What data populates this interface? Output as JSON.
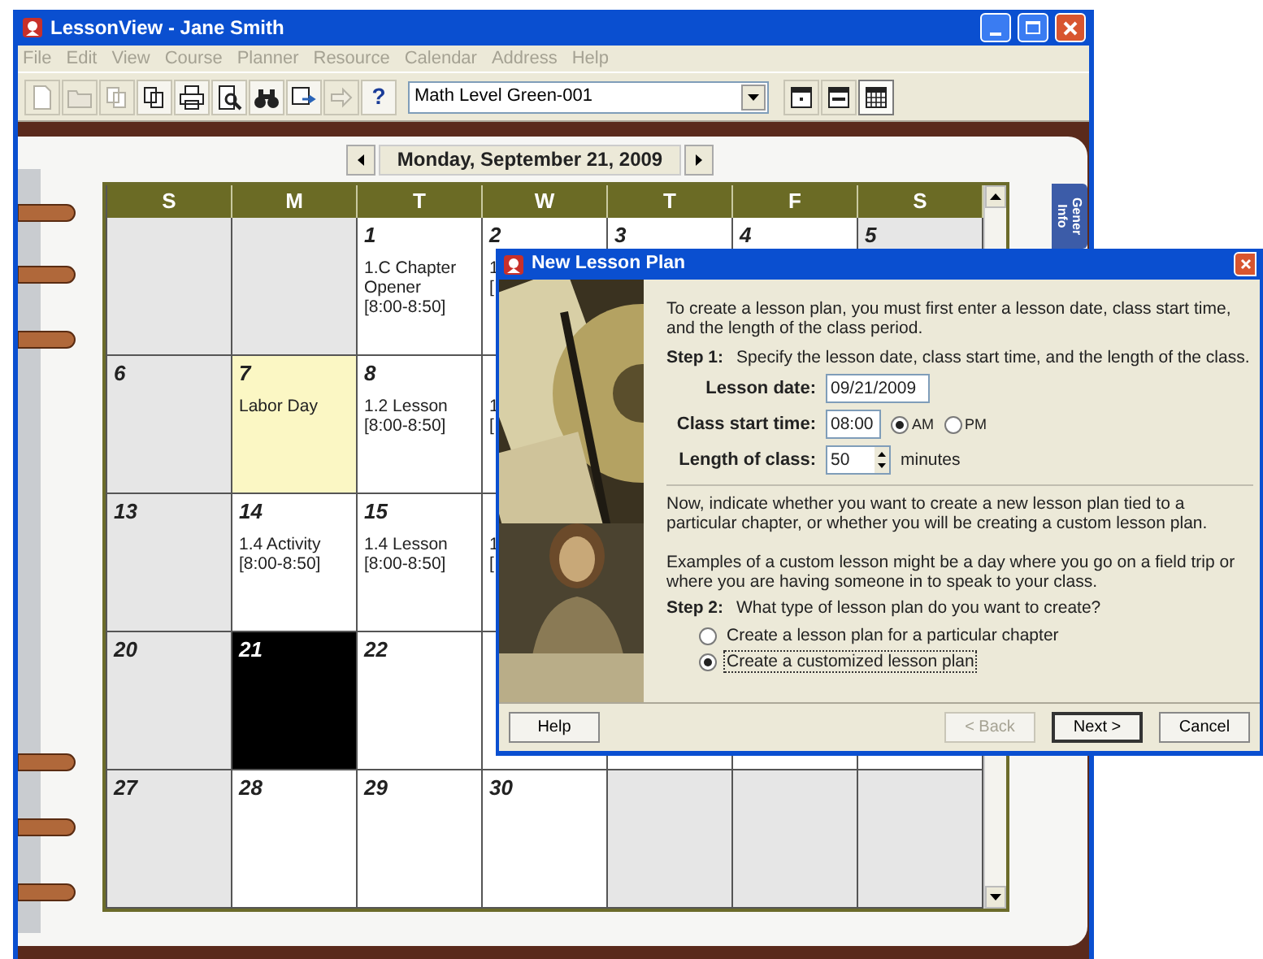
{
  "window": {
    "title": "LessonView - Jane Smith"
  },
  "menu": [
    {
      "label": "File",
      "disabled": true
    },
    {
      "label": "Edit",
      "disabled": true
    },
    {
      "label": "View",
      "disabled": true
    },
    {
      "label": "Course",
      "disabled": true
    },
    {
      "label": "Planner",
      "disabled": true
    },
    {
      "label": "Resource",
      "disabled": true
    },
    {
      "label": "Calendar",
      "disabled": true
    },
    {
      "label": "Address",
      "disabled": true
    },
    {
      "label": "Help",
      "disabled": true
    }
  ],
  "toolbar": [
    {
      "kind": "new",
      "disabled": true
    },
    {
      "kind": "open",
      "disabled": true
    },
    {
      "kind": "copy",
      "disabled": true
    },
    {
      "kind": "copy",
      "disabled": false
    },
    {
      "kind": "print",
      "disabled": false
    },
    {
      "kind": "preview",
      "disabled": false
    },
    {
      "kind": "find",
      "disabled": false
    },
    {
      "kind": "export",
      "disabled": false
    },
    {
      "kind": "forward",
      "disabled": true
    },
    {
      "kind": "help",
      "disabled": false,
      "label": "?"
    }
  ],
  "course_select": {
    "value": "Math Level Green-001"
  },
  "views": [
    {
      "kind": "day",
      "selected": false
    },
    {
      "kind": "week",
      "selected": false
    },
    {
      "kind": "month",
      "selected": true
    }
  ],
  "date_nav": {
    "label": "Monday, September 21, 2009"
  },
  "side_tab": {
    "label": "Gener Info"
  },
  "calendar": {
    "days": [
      "S",
      "M",
      "T",
      "W",
      "T",
      "F",
      "S"
    ],
    "weeks": [
      [
        {
          "kind": "outside",
          "selected": false
        },
        {
          "kind": "outside",
          "selected": false
        },
        {
          "kind": "weekday",
          "day": "1",
          "events": [
            "1.C Chapter Opener",
            "[8:00-8:50]"
          ],
          "selected": false
        },
        {
          "kind": "weekday",
          "day": "2",
          "events": [
            "1",
            "["
          ],
          "selected": false
        },
        {
          "kind": "weekday",
          "day": "3",
          "selected": false
        },
        {
          "kind": "weekday",
          "day": "4",
          "selected": false
        },
        {
          "kind": "weekend",
          "day": "5",
          "selected": false
        }
      ],
      [
        {
          "kind": "weekend",
          "day": "6",
          "selected": false
        },
        {
          "kind": "holiday",
          "day": "7",
          "events": [
            "Labor Day"
          ],
          "selected": false
        },
        {
          "kind": "weekday",
          "day": "8",
          "events": [
            "1.2 Lesson",
            "[8:00-8:50]"
          ],
          "selected": false
        },
        {
          "kind": "weekday",
          "events": [
            "1",
            "["
          ],
          "selected": false
        }
      ],
      [
        {
          "kind": "weekend",
          "day": "13",
          "selected": false
        },
        {
          "kind": "weekday",
          "day": "14",
          "events": [
            "1.4 Activity",
            "[8:00-8:50]"
          ],
          "selected": false
        },
        {
          "kind": "weekday",
          "day": "15",
          "events": [
            "1.4 Lesson",
            "[8:00-8:50]"
          ],
          "selected": false
        },
        {
          "kind": "weekday",
          "events": [
            "1",
            "["
          ],
          "selected": false
        }
      ],
      [
        {
          "kind": "weekend",
          "day": "20",
          "selected": false
        },
        {
          "kind": "weekday",
          "day": "21",
          "selected": true
        },
        {
          "kind": "weekday",
          "day": "22",
          "selected": false
        },
        {
          "kind": "weekday",
          "selected": false
        }
      ],
      [
        {
          "kind": "weekend",
          "day": "27",
          "selected": false
        },
        {
          "kind": "weekday",
          "day": "28",
          "selected": false
        },
        {
          "kind": "weekday",
          "day": "29",
          "selected": false
        },
        {
          "kind": "weekday",
          "day": "30",
          "selected": false
        },
        {
          "kind": "outside",
          "selected": false
        },
        {
          "kind": "outside",
          "selected": false
        },
        {
          "kind": "outside",
          "selected": false
        }
      ]
    ]
  },
  "dialog": {
    "title": "New Lesson Plan",
    "picture": {
      "kind": "picture"
    },
    "intro": "To create a lesson plan, you must first enter a lesson date, class start time, and the length of the class period.",
    "step1": {
      "label": "Step 1:",
      "text": "Specify the lesson date, class start time, and the length of the class."
    },
    "fields": [
      {
        "kind": "date",
        "label": "Lesson date:",
        "value": "09/21/2009"
      },
      {
        "kind": "time",
        "label": "Class start time:",
        "value": "08:00",
        "options": [
          {
            "label": "AM",
            "selected": true
          },
          {
            "label": "PM",
            "selected": false
          }
        ]
      },
      {
        "kind": "spin",
        "label": "Length of class:",
        "value": "50",
        "unit": "minutes"
      }
    ],
    "paragraphs": [
      "Now, indicate whether you want to create a new lesson plan tied to a particular chapter, or whether you will be creating a custom lesson plan.",
      "Examples of a custom lesson might be a day where you go on a field trip or where you are having someone in to speak to your class."
    ],
    "step2": {
      "label": "Step 2:",
      "text": "What type of lesson plan do you want to create?"
    },
    "choices": [
      {
        "label": "Create a lesson plan for a particular chapter",
        "selected": false
      },
      {
        "label": "Create a customized lesson plan",
        "selected": true
      }
    ],
    "buttons": [
      {
        "label": "Help",
        "kind": "help",
        "disabled": false
      },
      {
        "label": "< Back",
        "kind": "nav",
        "disabled": true
      },
      {
        "label": "Next >",
        "kind": "default",
        "disabled": false
      },
      {
        "label": "Cancel",
        "kind": "nav",
        "disabled": false
      }
    ]
  }
}
